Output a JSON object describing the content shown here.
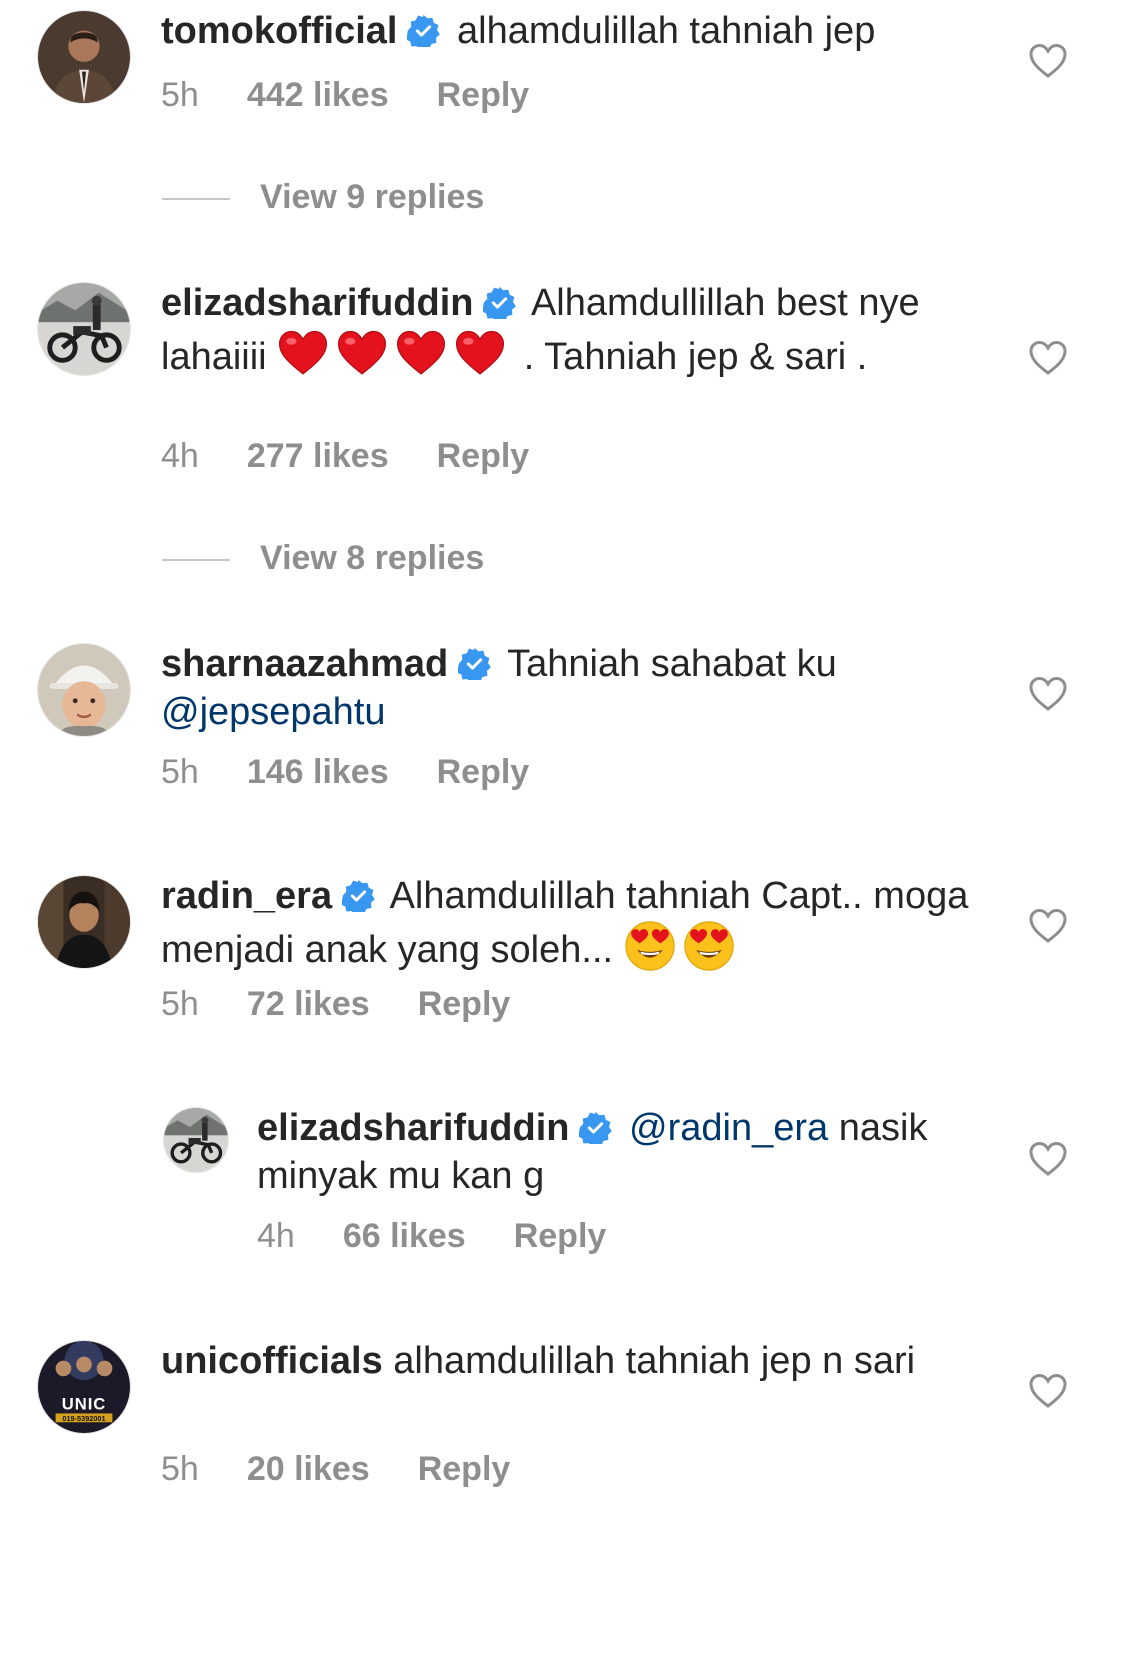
{
  "colors": {
    "text": "#262626",
    "muted": "#8e8e8e",
    "mention": "#00376b",
    "verified": "#3897f0"
  },
  "comments": [
    {
      "username": "tomokofficial",
      "verified": true,
      "text": "alhamdulillah tahniah jep",
      "time": "5h",
      "likes": "442 likes",
      "reply": "Reply",
      "view_replies": "View 9 replies"
    },
    {
      "username": "elizadsharifuddin",
      "verified": true,
      "text_a": "Alhamdullillah best nye lahaiiii",
      "emoji": "red-heart-emoji",
      "emoji_count": 4,
      "text_b": ". Tahniah jep & sari .",
      "time": "4h",
      "likes": "277 likes",
      "reply": "Reply",
      "view_replies": "View 8 replies"
    },
    {
      "username": "sharnaazahmad",
      "verified": true,
      "text": "Tahniah sahabat ku",
      "mention": "@jepsepahtu",
      "time": "5h",
      "likes": "146 likes",
      "reply": "Reply"
    },
    {
      "username": "radin_era",
      "verified": true,
      "text": "Alhamdulillah tahniah Capt.. moga menjadi anak yang soleh...",
      "emoji": "heart-eyes-emoji",
      "emoji_count": 2,
      "time": "5h",
      "likes": "72 likes",
      "reply": "Reply"
    },
    {
      "username": "elizadsharifuddin",
      "verified": true,
      "mention": "@radin_era",
      "text": "nasik minyak mu kan g",
      "time": "4h",
      "likes": "66 likes",
      "reply": "Reply"
    },
    {
      "username": "unicofficials",
      "verified": false,
      "text": "alhamdulillah tahniah jep n sari",
      "time": "5h",
      "likes": "20 likes",
      "reply": "Reply",
      "avatar_text": "UNIC",
      "avatar_subtext": "019-5392001"
    }
  ]
}
